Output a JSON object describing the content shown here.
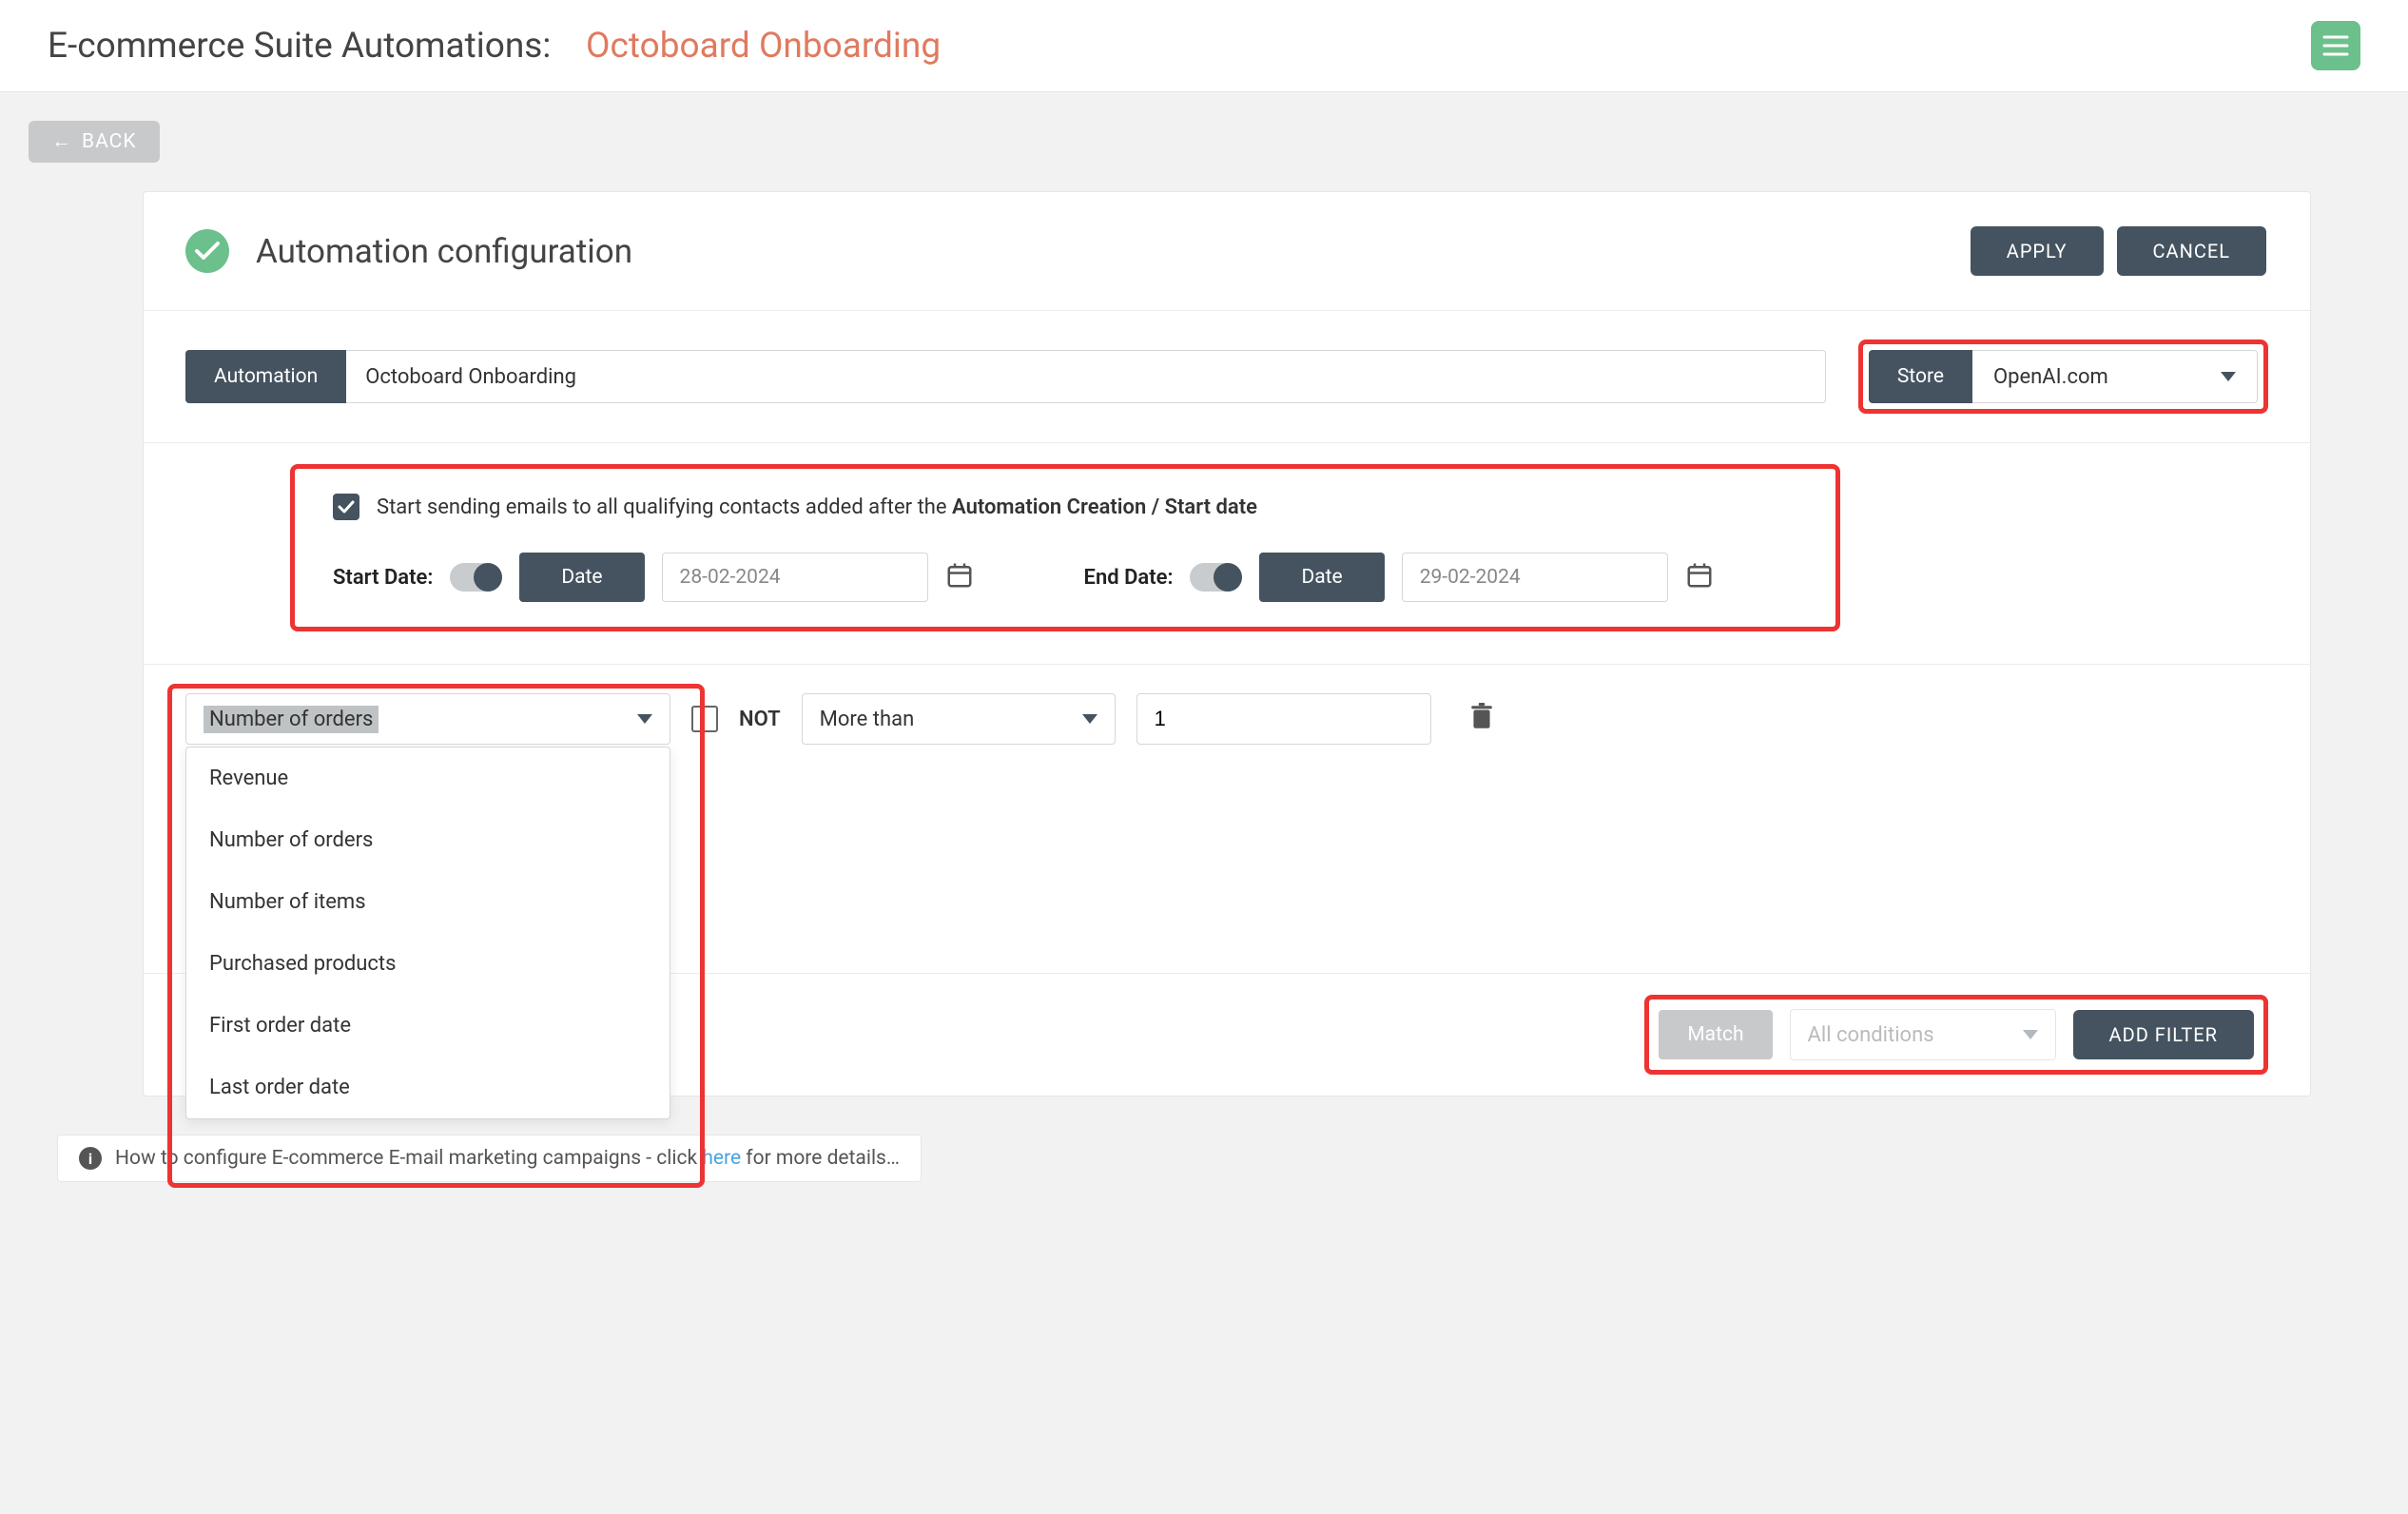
{
  "header": {
    "title_prefix": "E-commerce Suite Automations:",
    "title_name": "Octoboard Onboarding"
  },
  "back_label": "BACK",
  "card": {
    "title": "Automation configuration",
    "apply_label": "APPLY",
    "cancel_label": "CANCEL"
  },
  "automation": {
    "label": "Automation",
    "value": "Octoboard Onboarding"
  },
  "store": {
    "label": "Store",
    "selected": "OpenAI.com"
  },
  "dates": {
    "checkbox_prefix": "Start sending emails to all qualifying contacts added after the ",
    "checkbox_bold": "Automation Creation / Start date",
    "start_date_label": "Start Date:",
    "end_date_label": "End Date:",
    "date_badge": "Date",
    "start_value": "28-02-2024",
    "end_value": "29-02-2024"
  },
  "filter": {
    "selected_metric": "Number of orders",
    "options": [
      "Revenue",
      "Number of orders",
      "Number of items",
      "Purchased products",
      "First order date",
      "Last order date"
    ],
    "not_label": "NOT",
    "operator": "More than",
    "value": "1"
  },
  "match": {
    "label": "Match",
    "mode": "All conditions",
    "add_filter_label": "ADD FILTER"
  },
  "info": {
    "text_before": "How to configure E-commerce E-mail marketing campaigns - click ",
    "link": "here",
    "text_after": " for more details…"
  }
}
